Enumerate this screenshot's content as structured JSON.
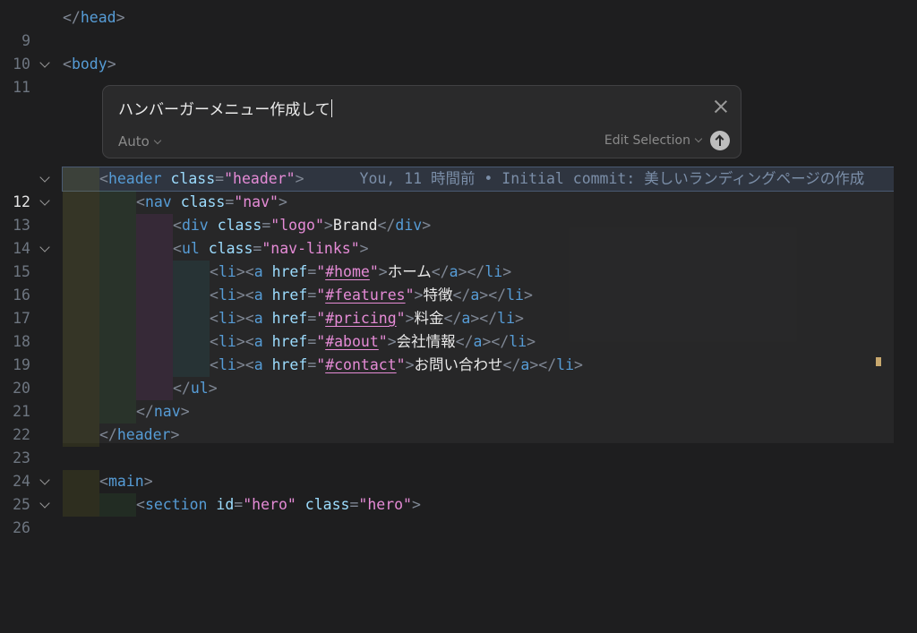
{
  "editor": {
    "lines": [
      {
        "num": "9",
        "text": "</head>"
      },
      {
        "num": "10",
        "text": ""
      },
      {
        "num": "11",
        "text": "<body>"
      },
      {
        "num": "12",
        "text": "<header class=\"header\">"
      },
      {
        "num": "13",
        "text": "<nav class=\"nav\">"
      },
      {
        "num": "14",
        "text": "<div class=\"logo\">Brand</div>"
      },
      {
        "num": "15",
        "text": "<ul class=\"nav-links\">"
      },
      {
        "num": "16",
        "text": "<li><a href=\"#home\">ホーム</a></li>"
      },
      {
        "num": "17",
        "text": "<li><a href=\"#features\">特徴</a></li>"
      },
      {
        "num": "18",
        "text": "<li><a href=\"#pricing\">料金</a></li>"
      },
      {
        "num": "19",
        "text": "<li><a href=\"#about\">会社情報</a></li>"
      },
      {
        "num": "20",
        "text": "<li><a href=\"#contact\">お問い合わせ</a></li>"
      },
      {
        "num": "21",
        "text": "</ul>"
      },
      {
        "num": "22",
        "text": "</nav>"
      },
      {
        "num": "23",
        "text": "</header>"
      },
      {
        "num": "24",
        "text": ""
      },
      {
        "num": "25",
        "text": "<main>"
      },
      {
        "num": "26",
        "text": "<section id=\"hero\" class=\"hero\">"
      }
    ],
    "blame": "You, 11 時間前 • Initial commit: 美しいランディングページの作成"
  },
  "prompt": {
    "input_value": "ハンバーガーメニュー作成して",
    "mode_label": "Auto",
    "selection_label": "Edit Selection"
  },
  "colors": {
    "background": "#1e1e1f",
    "tag": "#569cd6",
    "attribute": "#9cdcfe",
    "string": "#e58bd6"
  }
}
